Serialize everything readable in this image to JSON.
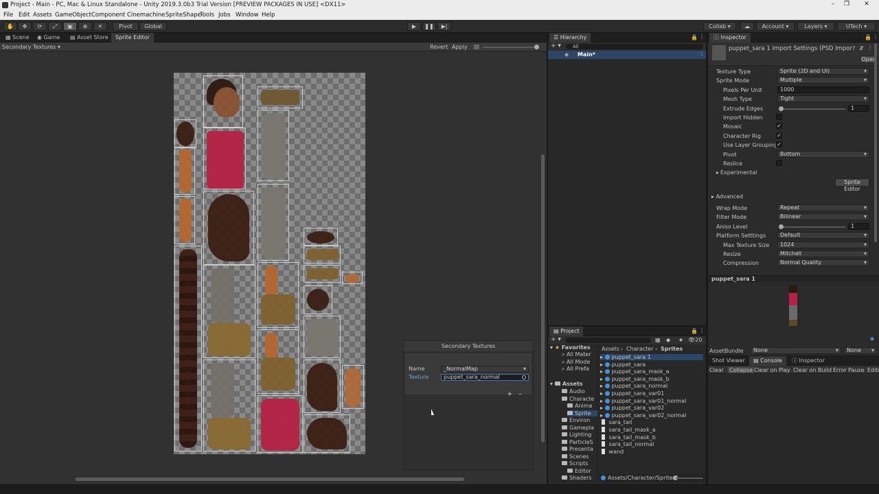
{
  "title": "Project - Main - PC, Mac & Linux Standalone - Unity 2019.3.0b3 Trial Version [PREVIEW PACKAGES IN USE] <DX11>",
  "menu": [
    "File",
    "Edit",
    "Assets",
    "GameObject",
    "Component",
    "Cinemachine",
    "SpriteShape",
    "Tools",
    "Jobs",
    "Window",
    "Help"
  ],
  "toolbar": {
    "pivot": "Pivot",
    "global": "Global",
    "collab": "Collab",
    "account": "Account",
    "layers": "Layers",
    "layout": "UTech"
  },
  "scene_tabs": [
    "Scene",
    "Game",
    "Asset Store",
    "Sprite Editor"
  ],
  "sprite_editor": {
    "mode": "Secondary Textures",
    "revert": "Revert",
    "apply": "Apply"
  },
  "secondary": {
    "title": "Secondary Textures",
    "name_label": "Name",
    "name_value": "_NormalMap",
    "texture_label": "Texture",
    "texture_value": "puppet_sara_normal",
    "add": "+",
    "remove": "–"
  },
  "hierarchy": {
    "tab": "Hierarchy",
    "search": "All",
    "root": "Main*"
  },
  "inspector": {
    "tab": "Inspector",
    "header": "puppet_sara 1 Import Settings (PSD Impor",
    "open": "Open",
    "fields": [
      {
        "label": "Texture Type",
        "value": "Sprite (2D and UI)",
        "kind": "dd"
      },
      {
        "label": "Sprite Mode",
        "value": "Multiple",
        "kind": "dd"
      },
      {
        "label": "Pixels Per Unit",
        "value": "1000",
        "kind": "text"
      },
      {
        "label": "Mesh Type",
        "value": "Tight",
        "kind": "dd"
      },
      {
        "label": "Extrude Edges",
        "value": "1",
        "kind": "slider"
      },
      {
        "label": "Import Hidden",
        "value": "",
        "kind": "check"
      },
      {
        "label": "Mosaic",
        "value": "✓",
        "kind": "check"
      },
      {
        "label": "Character Rig",
        "value": "✓",
        "kind": "check"
      },
      {
        "label": "Use Layer Grouping",
        "value": "✓",
        "kind": "check"
      },
      {
        "label": "Pivot",
        "value": "Bottom",
        "kind": "dd"
      },
      {
        "label": "Reslice",
        "value": "",
        "kind": "check"
      },
      {
        "label": "Experimental",
        "value": "",
        "kind": "fold"
      }
    ],
    "sprite_editor_btn": "Sprite Editor",
    "advanced": "Advanced",
    "fields2": [
      {
        "label": "Wrap Mode",
        "value": "Repeat",
        "kind": "dd"
      },
      {
        "label": "Filter Mode",
        "value": "Bilinear",
        "kind": "dd"
      },
      {
        "label": "Aniso Level",
        "value": "1",
        "kind": "slider"
      },
      {
        "label": "Platform Setttings",
        "value": "Default",
        "kind": "dd"
      },
      {
        "label": "Max Texture Size",
        "value": "1024",
        "kind": "dd"
      },
      {
        "label": "Resize",
        "value": "Mitchell",
        "kind": "dd"
      },
      {
        "label": "Compression",
        "value": "Normal Quality",
        "kind": "dd"
      }
    ],
    "preview_name": "puppet_sara 1",
    "assetbundle_label": "AssetBundle",
    "assetbundle_value": "None",
    "assetbundle_variant": "None"
  },
  "project": {
    "tab": "Project",
    "count": "20",
    "breadcrumb": [
      "Assets",
      "Character",
      "Sprites"
    ],
    "favorites": "Favorites",
    "fav_items": [
      "All Mater",
      "All Mode",
      "All Prefa"
    ],
    "assets_root": "Assets",
    "folders": [
      "Audio",
      "Characte",
      "Anima",
      "Sprite",
      "Environ",
      "Gamepla",
      "Lighting",
      "ParticleS",
      "Presenta",
      "Scenes",
      "Scripts",
      "Editor",
      "Shaders"
    ],
    "files": [
      "puppet_sara 1",
      "puppet_sara",
      "puppet_sara_mask_a",
      "puppet_sara_mask_b",
      "puppet_sara_normal",
      "puppet_sara_var01",
      "puppet_sara_var01_normal",
      "puppet_sara_var02",
      "puppet_sara_var02_normal",
      "sara_tail",
      "sara_tail_mask_a",
      "sara_tail_mask_b",
      "sara_tail_normal",
      "wand"
    ],
    "path": "Assets/Character/Sprites/"
  },
  "console": {
    "tabs": [
      "Shot Viewer",
      "Console",
      "Inspector"
    ],
    "buttons": [
      "Clear",
      "Collapse",
      "Clear on Play",
      "Clear on Build",
      "Error Pause",
      "Edito"
    ]
  }
}
